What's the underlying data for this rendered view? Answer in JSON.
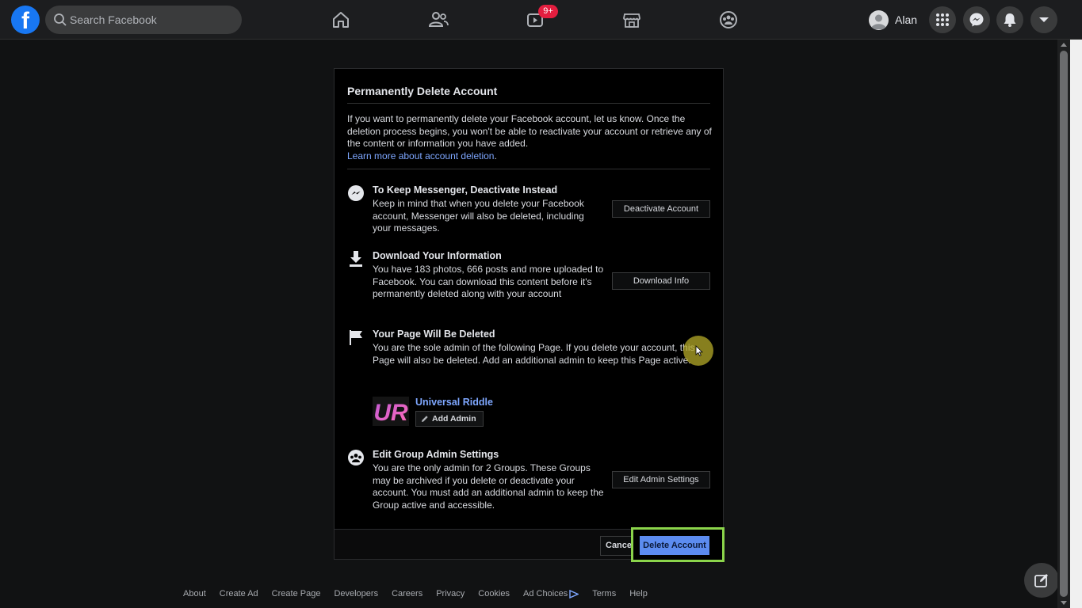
{
  "nav": {
    "search_placeholder": "Search Facebook",
    "watch_badge": "9+",
    "profile_name": "Alan"
  },
  "dialog": {
    "title": "Permanently Delete Account",
    "intro": "If you want to permanently delete your Facebook account, let us know. Once the deletion process begins, you won't be able to reactivate your account or retrieve any of the content or information you have added.",
    "intro_link": "Learn more about account deletion",
    "intro_link_suffix": ".",
    "sections": [
      {
        "title": "To Keep Messenger, Deactivate Instead",
        "body": "Keep in mind that when you delete your Facebook account, Messenger will also be deleted, including your messages.",
        "button": "Deactivate Account"
      },
      {
        "title": "Download Your Information",
        "body": "You have 183 photos, 666 posts and more uploaded to Facebook. You can download this content before it's permanently deleted along with your account",
        "button": "Download Info"
      },
      {
        "title": "Your Page Will Be Deleted",
        "body": "You are the sole admin of the following Page. If you delete your account, this Page will also be deleted. Add an additional admin to keep this Page active."
      },
      {
        "title": "Edit Group Admin Settings",
        "body": "You are the only admin for 2 Groups. These Groups may be archived if you delete or deactivate your account. You must add an additional admin to keep the Group active and accessible.",
        "button": "Edit Admin Settings"
      }
    ],
    "page": {
      "name": "Universal Riddle",
      "logo_text": "UR",
      "add_admin": "Add Admin"
    },
    "cancel": "Cancel",
    "delete": "Delete Account"
  },
  "footer_links": [
    "About",
    "Create Ad",
    "Create Page",
    "Developers",
    "Careers",
    "Privacy",
    "Cookies",
    "Ad Choices",
    "Terms",
    "Help"
  ],
  "colors": {
    "link": "#7ea7ff",
    "primary_button": "#5c8cf0",
    "highlight": "#8bd44b",
    "badge": "#e41e3f"
  }
}
